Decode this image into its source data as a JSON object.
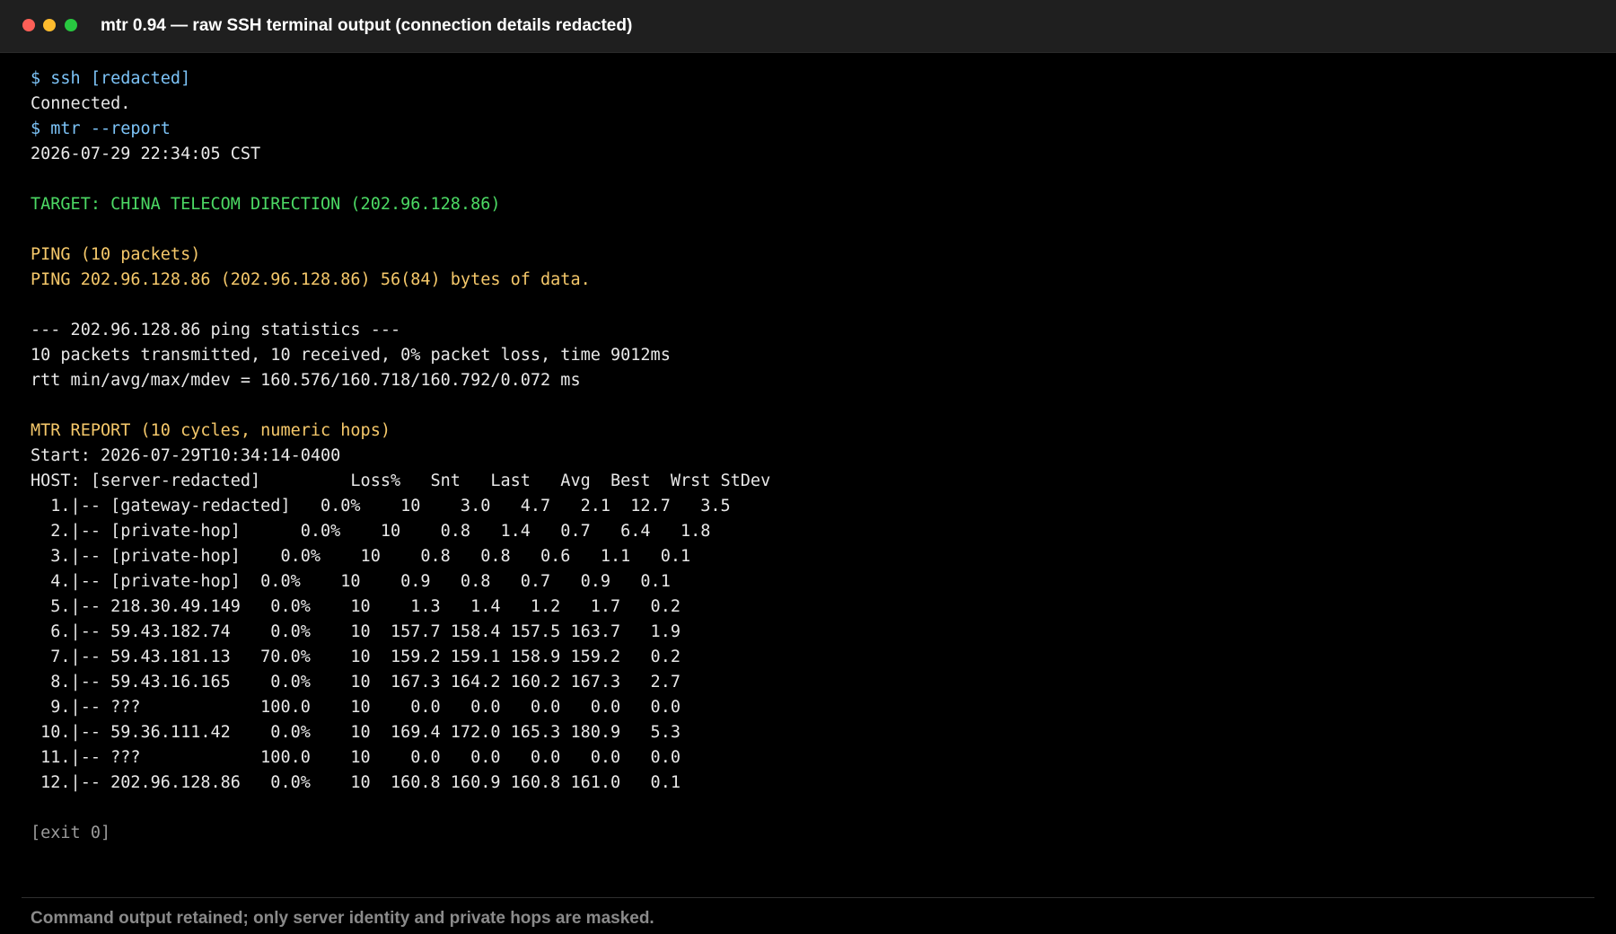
{
  "window": {
    "title": "mtr 0.94 — raw SSH terminal output (connection details redacted)",
    "controls": [
      {
        "name": "close-button",
        "color": "#ff5f57"
      },
      {
        "name": "minimize-button",
        "color": "#febc2e"
      },
      {
        "name": "zoom-button",
        "color": "#28c840"
      }
    ]
  },
  "colors": {
    "prompt": "#7cc3f7",
    "text": "#e8e8e8",
    "target": "#4cd964",
    "section": "#f5c86a",
    "muted": "#9a9a9a"
  },
  "terminal": {
    "lines": [
      {
        "text": "$ ssh [redacted]",
        "style": "prompt"
      },
      {
        "text": "Connected.",
        "style": "text"
      },
      {
        "text": "$ mtr --report",
        "style": "prompt"
      },
      {
        "text": "2026-07-29 22:34:05 CST",
        "style": "text"
      },
      {
        "text": "",
        "style": "text"
      },
      {
        "text": "TARGET: CHINA TELECOM DIRECTION (202.96.128.86)",
        "style": "target"
      },
      {
        "text": "",
        "style": "text"
      },
      {
        "text": "PING (10 packets)",
        "style": "section"
      },
      {
        "text": "PING 202.96.128.86 (202.96.128.86) 56(84) bytes of data.",
        "style": "section"
      },
      {
        "text": "",
        "style": "text"
      },
      {
        "text": "--- 202.96.128.86 ping statistics ---",
        "style": "text"
      },
      {
        "text": "10 packets transmitted, 10 received, 0% packet loss, time 9012ms",
        "style": "text"
      },
      {
        "text": "rtt min/avg/max/mdev = 160.576/160.718/160.792/0.072 ms",
        "style": "text"
      },
      {
        "text": "",
        "style": "text"
      },
      {
        "text": "MTR REPORT (10 cycles, numeric hops)",
        "style": "section"
      },
      {
        "text": "Start: 2026-07-29T10:34:14-0400",
        "style": "text"
      },
      {
        "text": "HOST: [server-redacted]         Loss%   Snt   Last   Avg  Best  Wrst StDev",
        "style": "text"
      },
      {
        "text": "  1.|-- [gateway-redacted]   0.0%    10    3.0   4.7   2.1  12.7   3.5",
        "style": "text"
      },
      {
        "text": "  2.|-- [private-hop]      0.0%    10    0.8   1.4   0.7   6.4   1.8",
        "style": "text"
      },
      {
        "text": "  3.|-- [private-hop]    0.0%    10    0.8   0.8   0.6   1.1   0.1",
        "style": "text"
      },
      {
        "text": "  4.|-- [private-hop]  0.0%    10    0.9   0.8   0.7   0.9   0.1",
        "style": "text"
      },
      {
        "text": "  5.|-- 218.30.49.149   0.0%    10    1.3   1.4   1.2   1.7   0.2",
        "style": "text"
      },
      {
        "text": "  6.|-- 59.43.182.74    0.0%    10  157.7 158.4 157.5 163.7   1.9",
        "style": "text"
      },
      {
        "text": "  7.|-- 59.43.181.13   70.0%    10  159.2 159.1 158.9 159.2   0.2",
        "style": "text"
      },
      {
        "text": "  8.|-- 59.43.16.165    0.0%    10  167.3 164.2 160.2 167.3   2.7",
        "style": "text"
      },
      {
        "text": "  9.|-- ???            100.0    10    0.0   0.0   0.0   0.0   0.0",
        "style": "text"
      },
      {
        "text": " 10.|-- 59.36.111.42    0.0%    10  169.4 172.0 165.3 180.9   5.3",
        "style": "text"
      },
      {
        "text": " 11.|-- ???            100.0    10    0.0   0.0   0.0   0.0   0.0",
        "style": "text"
      },
      {
        "text": " 12.|-- 202.96.128.86   0.0%    10  160.8 160.9 160.8 161.0   0.1",
        "style": "text"
      },
      {
        "text": "",
        "style": "text"
      },
      {
        "text": "[exit 0]",
        "style": "muted"
      }
    ]
  },
  "footer": {
    "note": "Command output retained; only server identity and private hops are masked."
  }
}
